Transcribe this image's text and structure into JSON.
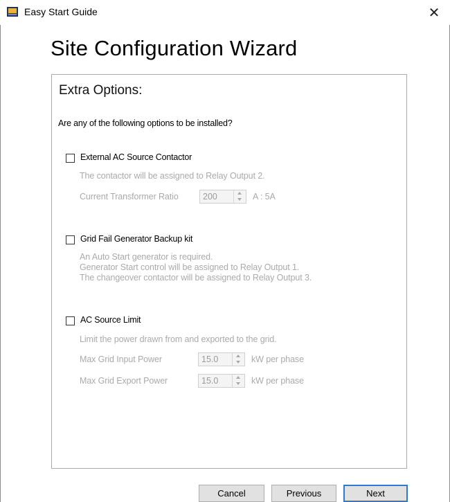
{
  "window": {
    "title": "Easy Start Guide",
    "close_glyph": "✕",
    "heading": "Site Configuration Wizard"
  },
  "panel": {
    "section_title": "Extra Options:",
    "question": "Are any of the following options to be installed?",
    "options": [
      {
        "label": "External AC Source Contactor",
        "checked": false,
        "lines": [
          "The contactor will be assigned to Relay Output 2."
        ],
        "fields": [
          {
            "label": "Current Transformer Ratio",
            "value": "200",
            "unit": "A : 5A"
          }
        ]
      },
      {
        "label": "Grid Fail Generator Backup kit",
        "checked": false,
        "lines": [
          "An Auto Start generator is required.",
          "Generator Start control will be assigned to Relay Output 1.",
          "The changeover contactor will be assigned to Relay Output 3."
        ],
        "fields": []
      },
      {
        "label": "AC Source Limit",
        "checked": false,
        "lines": [
          "Limit the power drawn from and exported to the grid."
        ],
        "fields": [
          {
            "label": "Max Grid Input Power",
            "value": "15.0",
            "unit": "kW per phase"
          },
          {
            "label": "Max Grid Export Power",
            "value": "15.0",
            "unit": "kW per phase"
          }
        ]
      }
    ]
  },
  "buttons": {
    "cancel": "Cancel",
    "previous": "Previous",
    "next": "Next"
  },
  "colors": {
    "disabled_text": "#aaaaaa",
    "default_button_border": "#2f78d4",
    "button_face": "#e1e1e1"
  }
}
